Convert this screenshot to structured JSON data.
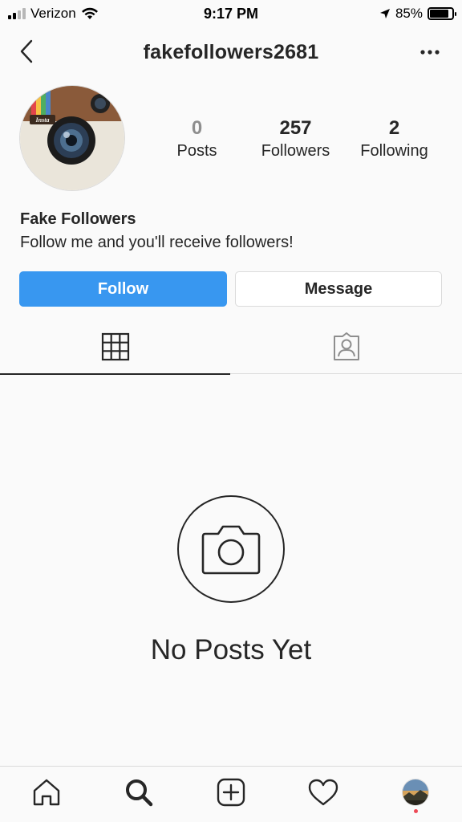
{
  "status_bar": {
    "carrier": "Verizon",
    "time": "9:17 PM",
    "battery_percent": "85%",
    "battery_level": 0.85
  },
  "header": {
    "username": "fakefollowers2681"
  },
  "profile": {
    "stats": [
      {
        "value": "0",
        "label": "Posts"
      },
      {
        "value": "257",
        "label": "Followers"
      },
      {
        "value": "2",
        "label": "Following"
      }
    ],
    "name": "Fake Followers",
    "bio": "Follow me and you'll receive followers!",
    "avatar_logo_text": "Insta"
  },
  "actions": {
    "follow_label": "Follow",
    "message_label": "Message"
  },
  "tabs": [
    {
      "icon": "grid-icon",
      "active": true
    },
    {
      "icon": "tagged-icon",
      "active": false
    }
  ],
  "empty_state": {
    "icon": "camera-icon",
    "text": "No Posts Yet"
  },
  "bottom_nav": {
    "items": [
      "home-icon",
      "search-icon",
      "add-post-icon",
      "heart-icon",
      "profile-avatar"
    ]
  },
  "colors": {
    "follow_blue": "#3897f0",
    "notification_red": "#ed4956",
    "text_dark": "#262626",
    "muted": "#8e8e8e"
  }
}
